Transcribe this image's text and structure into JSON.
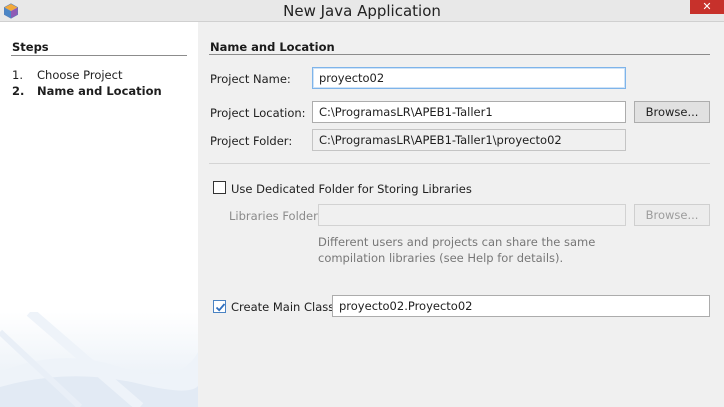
{
  "window": {
    "title": "New Java Application",
    "close_glyph": "✕",
    "icon": "netbeans-cube-icon"
  },
  "steps": {
    "title": "Steps",
    "items": [
      {
        "num": "1.",
        "label": "Choose Project",
        "current": false
      },
      {
        "num": "2.",
        "label": "Name and Location",
        "current": true
      }
    ]
  },
  "main": {
    "section_title": "Name and Location",
    "project_name": {
      "label": "Project Name:",
      "value": "proyecto02"
    },
    "project_location": {
      "label": "Project Location:",
      "value": "C:\\ProgramasLR\\APEB1-Taller1",
      "browse": "Browse..."
    },
    "project_folder": {
      "label": "Project Folder:",
      "value": "C:\\ProgramasLR\\APEB1-Taller1\\proyecto02"
    },
    "dedicated_folder": {
      "label": "Use Dedicated Folder for Storing Libraries",
      "checked": false
    },
    "libraries_folder": {
      "label": "Libraries Folder:",
      "value": "",
      "browse": "Browse..."
    },
    "hint_lines": [
      "Different users and projects can share the same",
      "compilation libraries (see Help for details)."
    ],
    "main_class": {
      "label": "Create Main Class",
      "checked": true,
      "value": "proyecto02.Proyecto02"
    }
  },
  "colors": {
    "close_button": "#c7312b",
    "focus_border": "#7eb4ea",
    "checkbox_check": "#2f6fbf"
  }
}
